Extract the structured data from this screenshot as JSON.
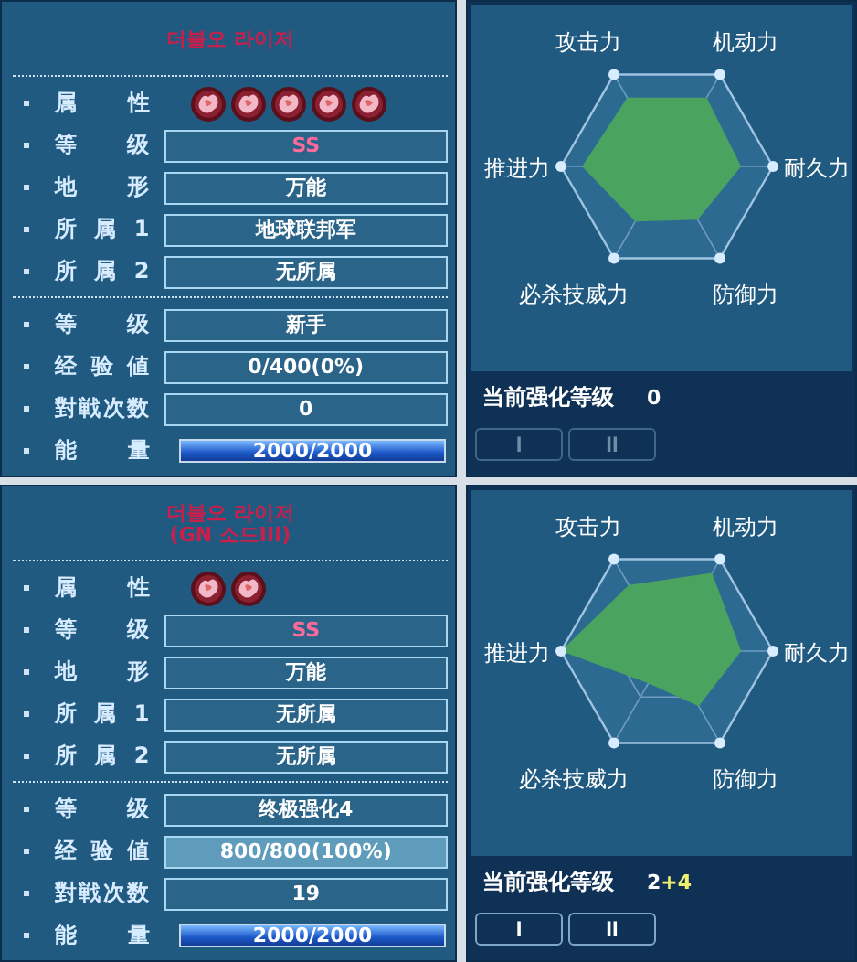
{
  "units": [
    {
      "name_lines": [
        "더블오 라이저"
      ],
      "attributes": [
        {
          "kind": "flower"
        },
        {
          "kind": "flower"
        },
        {
          "kind": "flower"
        },
        {
          "kind": "flower"
        },
        {
          "kind": "flower"
        }
      ],
      "info_rows": [
        {
          "label": "等级",
          "value": "SS",
          "color": "#ff6a9a"
        },
        {
          "label": "地形",
          "value": "万能",
          "color": "#ffffff"
        },
        {
          "label": "所属1",
          "value": "地球联邦军",
          "color": "#ffffff"
        },
        {
          "label": "所属2",
          "value": "无所属",
          "color": "#ffffff"
        }
      ],
      "progress_rows": [
        {
          "kind": "text",
          "label": "等级",
          "value": "新手",
          "highlighted": false
        },
        {
          "kind": "text",
          "label": "经验値",
          "value": "0/400(0%)",
          "highlighted": false
        },
        {
          "kind": "text",
          "label": "對戦次数",
          "value": "0",
          "highlighted": false
        },
        {
          "kind": "bar",
          "label": "能量",
          "value": "2000/2000",
          "level": 1
        }
      ],
      "attribute_label": "属性",
      "radar_labels": [
        "攻击力",
        "机动力",
        "耐久力",
        "防御力",
        "必杀技威力",
        "推进力"
      ],
      "enhance_label": "当前强化等级",
      "enhance_base": "0",
      "buttons": [
        {
          "label": "I",
          "disabled": true
        },
        {
          "label": "II",
          "disabled": true
        }
      ]
    },
    {
      "name_lines": [
        "더블오 라이저",
        "(GN 소드III)"
      ],
      "attributes": [
        {
          "kind": "flower"
        },
        {
          "kind": "flower"
        }
      ],
      "info_rows": [
        {
          "label": "等级",
          "value": "SS",
          "color": "#ff6a9a"
        },
        {
          "label": "地形",
          "value": "万能",
          "color": "#ffffff"
        },
        {
          "label": "所属1",
          "value": "无所属",
          "color": "#ffffff"
        },
        {
          "label": "所属2",
          "value": "无所属",
          "color": "#ffffff"
        }
      ],
      "progress_rows": [
        {
          "kind": "text",
          "label": "等级",
          "value": "终极强化4",
          "highlighted": false
        },
        {
          "kind": "text",
          "label": "经验値",
          "value": "800/800(100%)",
          "highlighted": true
        },
        {
          "kind": "text",
          "label": "對戦次数",
          "value": "19",
          "highlighted": false
        },
        {
          "kind": "bar",
          "label": "能量",
          "value": "2000/2000",
          "level": 1
        }
      ],
      "attribute_label": "属性",
      "radar_labels": [
        "攻击力",
        "机动力",
        "耐久力",
        "防御力",
        "必杀技威力",
        "推进力"
      ],
      "enhance_label": "当前强化等级",
      "enhance_base": "2",
      "enhance_bonus": "+4",
      "buttons": [
        {
          "label": "I",
          "disabled": false
        },
        {
          "label": "II",
          "disabled": false
        }
      ]
    }
  ]
}
